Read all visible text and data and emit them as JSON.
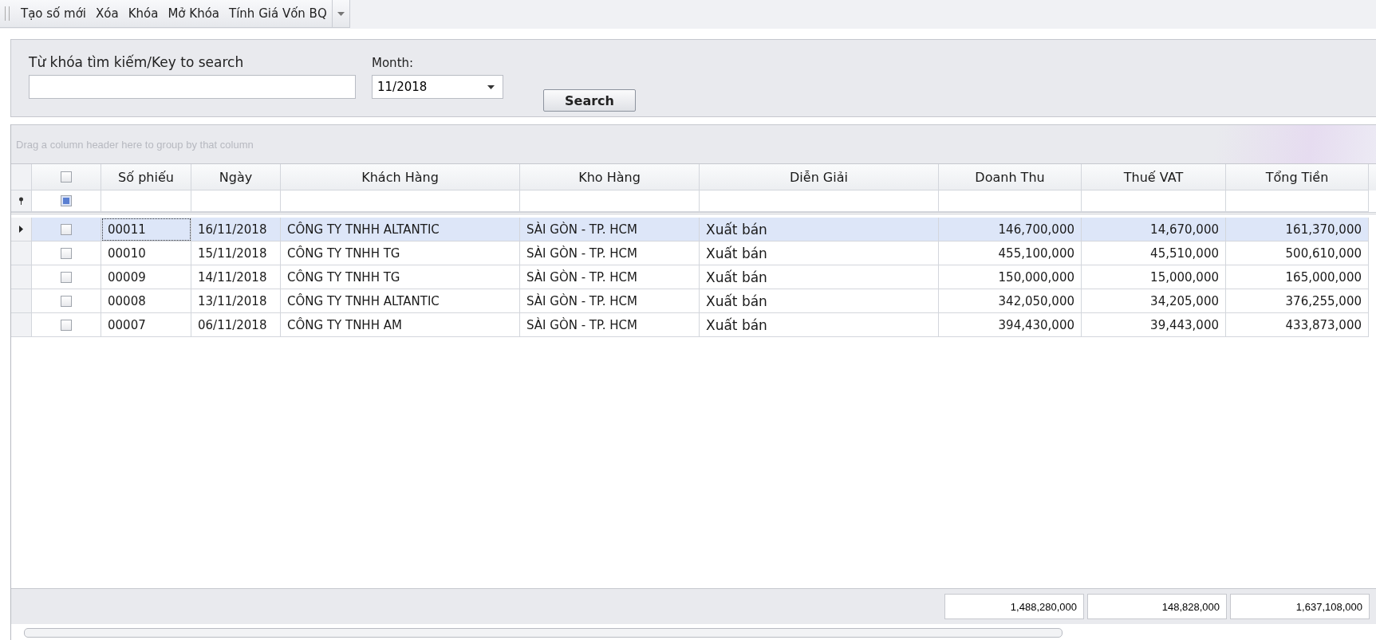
{
  "toolbar": {
    "items": [
      "Tạo số mới",
      "Xóa",
      "Khóa",
      "Mở Khóa",
      "Tính Giá Vốn BQ"
    ]
  },
  "search_panel": {
    "keyword_label": "Từ khóa tìm kiếm/Key to search",
    "month_label": "Month:",
    "month_value": "11/2018",
    "search_button": "Search"
  },
  "grid": {
    "group_hint": "Drag a column header here to group by that column",
    "header_checkbox": {
      "checked": false
    },
    "filter_checkbox": {
      "checked": true
    },
    "columns": [
      {
        "label": "Số phiếu"
      },
      {
        "label": "Ngày"
      },
      {
        "label": "Khách Hàng"
      },
      {
        "label": "Kho Hàng"
      },
      {
        "label": "Diễn Giải"
      },
      {
        "label": "Doanh Thu"
      },
      {
        "label": "Thuế VAT"
      },
      {
        "label": "Tổng Tiền"
      }
    ],
    "rows": [
      {
        "selected": true,
        "checked": false,
        "cells": [
          "00011",
          "16/11/2018",
          "CÔNG TY TNHH ALTANTIC",
          "SÀI GÒN - TP. HCM",
          "Xuất bán",
          "146,700,000",
          "14,670,000",
          "161,370,000"
        ]
      },
      {
        "selected": false,
        "checked": false,
        "cells": [
          "00010",
          "15/11/2018",
          "CÔNG TY TNHH TG",
          "SÀI GÒN - TP. HCM",
          "Xuất bán",
          "455,100,000",
          "45,510,000",
          "500,610,000"
        ]
      },
      {
        "selected": false,
        "checked": false,
        "cells": [
          "00009",
          "14/11/2018",
          "CÔNG TY TNHH TG",
          "SÀI GÒN - TP. HCM",
          "Xuất bán",
          "150,000,000",
          "15,000,000",
          "165,000,000"
        ]
      },
      {
        "selected": false,
        "checked": false,
        "cells": [
          "00008",
          "13/11/2018",
          "CÔNG TY TNHH ALTANTIC",
          "SÀI GÒN - TP. HCM",
          "Xuất bán",
          "342,050,000",
          "34,205,000",
          "376,255,000"
        ]
      },
      {
        "selected": false,
        "checked": false,
        "cells": [
          "00007",
          "06/11/2018",
          "CÔNG TY TNHH AM",
          "SÀI GÒN - TP. HCM",
          "Xuất bán",
          "394,430,000",
          "39,443,000",
          "433,873,000"
        ]
      }
    ],
    "totals": [
      "1,488,280,000",
      "148,828,000",
      "1,637,108,000"
    ]
  }
}
